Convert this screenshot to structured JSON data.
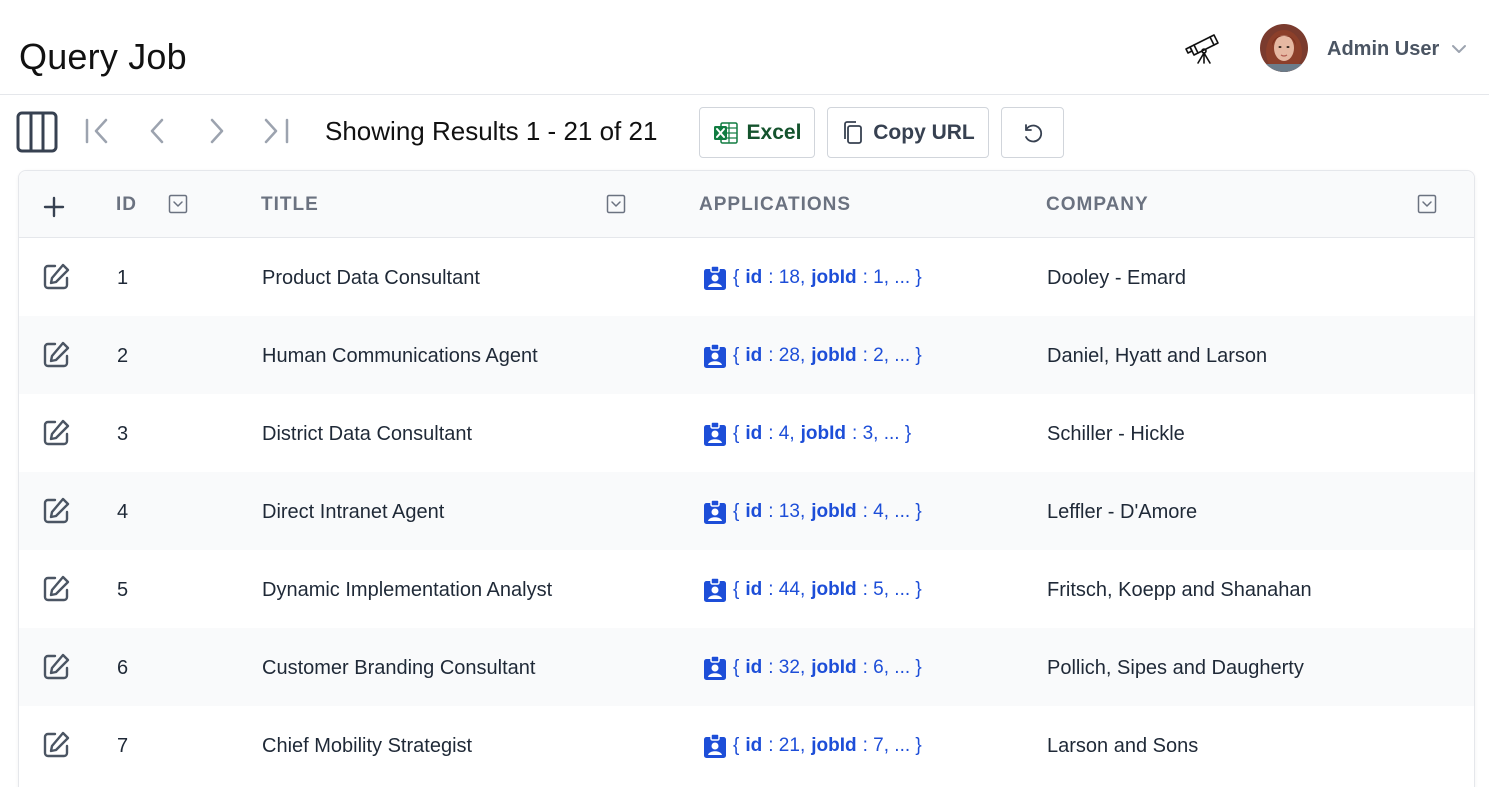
{
  "header": {
    "title": "Query Job",
    "user_name": "Admin User"
  },
  "toolbar": {
    "results_text": "Showing Results 1 - 21 of 21",
    "excel_label": "Excel",
    "copy_url_label": "Copy URL"
  },
  "table": {
    "columns": {
      "id": "ID",
      "title": "TITLE",
      "applications": "APPLICATIONS",
      "company": "COMPANY"
    },
    "rows": [
      {
        "id": "1",
        "title": "Product Data Consultant",
        "app_open": "{",
        "app_k1": "id",
        "app_v1": ": 18, ",
        "app_k2": "jobId",
        "app_v2": ": 1, ... }",
        "company": "Dooley - Emard"
      },
      {
        "id": "2",
        "title": "Human Communications Agent",
        "app_open": "{",
        "app_k1": "id",
        "app_v1": ": 28, ",
        "app_k2": "jobId",
        "app_v2": ": 2, ... }",
        "company": "Daniel, Hyatt and Larson"
      },
      {
        "id": "3",
        "title": "District Data Consultant",
        "app_open": "{",
        "app_k1": "id",
        "app_v1": ": 4, ",
        "app_k2": "jobId",
        "app_v2": ": 3, ... }",
        "company": "Schiller - Hickle"
      },
      {
        "id": "4",
        "title": "Direct Intranet Agent",
        "app_open": "{",
        "app_k1": "id",
        "app_v1": ": 13, ",
        "app_k2": "jobId",
        "app_v2": ": 4, ... }",
        "company": "Leffler - D'Amore"
      },
      {
        "id": "5",
        "title": "Dynamic Implementation Analyst",
        "app_open": "{",
        "app_k1": "id",
        "app_v1": ": 44, ",
        "app_k2": "jobId",
        "app_v2": ": 5, ... }",
        "company": "Fritsch, Koepp and Shanahan"
      },
      {
        "id": "6",
        "title": "Customer Branding Consultant",
        "app_open": "{",
        "app_k1": "id",
        "app_v1": ": 32, ",
        "app_k2": "jobId",
        "app_v2": ": 6, ... }",
        "company": "Pollich, Sipes and Daugherty"
      },
      {
        "id": "7",
        "title": "Chief Mobility Strategist",
        "app_open": "{",
        "app_k1": "id",
        "app_v1": ": 21, ",
        "app_k2": "jobId",
        "app_v2": ": 7, ... }",
        "company": "Larson and Sons"
      }
    ]
  },
  "colors": {
    "link": "#1d4ed8",
    "excel_green": "#107c41",
    "row_alt": "#f9fafb",
    "header_text": "#6b7280"
  },
  "icons": [
    "telescope-icon",
    "avatar",
    "chevron-down-icon",
    "columns-icon",
    "first-page-icon",
    "previous-page-icon",
    "next-page-icon",
    "last-page-icon",
    "excel-icon",
    "copy-icon",
    "undo-icon",
    "plus-icon",
    "filter-icon",
    "edit-icon",
    "contact-icon"
  ]
}
